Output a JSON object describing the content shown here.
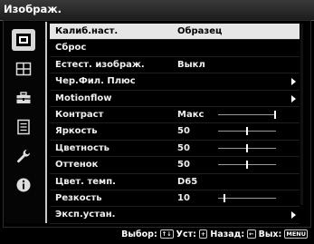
{
  "title": "Изображ.",
  "sidebar": {
    "items": [
      {
        "icon": "picture-icon",
        "active": true
      },
      {
        "icon": "screen-layout-icon",
        "active": false
      },
      {
        "icon": "toolbox-icon",
        "active": false
      },
      {
        "icon": "list-icon",
        "active": false
      },
      {
        "icon": "wrench-icon",
        "active": false
      },
      {
        "icon": "info-icon",
        "active": false
      }
    ]
  },
  "menu": {
    "rows": [
      {
        "label": "Калиб.наст.",
        "value": "Образец",
        "selected": true
      },
      {
        "label": "Сброс",
        "value": ""
      },
      {
        "label": "Естест. изображ.",
        "value": "Выкл"
      },
      {
        "label": "Чер.Фил. Плюс",
        "value": "",
        "submenu": true
      },
      {
        "label": "Motionflow",
        "value": "",
        "submenu": true
      },
      {
        "label": "Контраст",
        "value": "Макс",
        "slider": 1.0
      },
      {
        "label": "Яркость",
        "value": "50",
        "slider": 0.5
      },
      {
        "label": "Цветность",
        "value": "50",
        "slider": 0.5
      },
      {
        "label": "Оттенок",
        "value": "50",
        "slider": 0.5
      },
      {
        "label": "Цвет. темп.",
        "value": "D65"
      },
      {
        "label": "Резкость",
        "value": "10",
        "slider": 0.1
      },
      {
        "label": "Эксп.устан.",
        "value": "",
        "submenu": true
      }
    ]
  },
  "footer": {
    "select_label": "Выбор:",
    "select_key": "↑↓",
    "set_label": "Уст:",
    "set_key": "+",
    "back_label": "Назад:",
    "back_key": "←",
    "exit_label": "Вых:",
    "exit_key": "MENU"
  },
  "colors": {
    "background": "#000000",
    "selected_row": "#e6e6e6",
    "accent": "#c8c8c8"
  }
}
